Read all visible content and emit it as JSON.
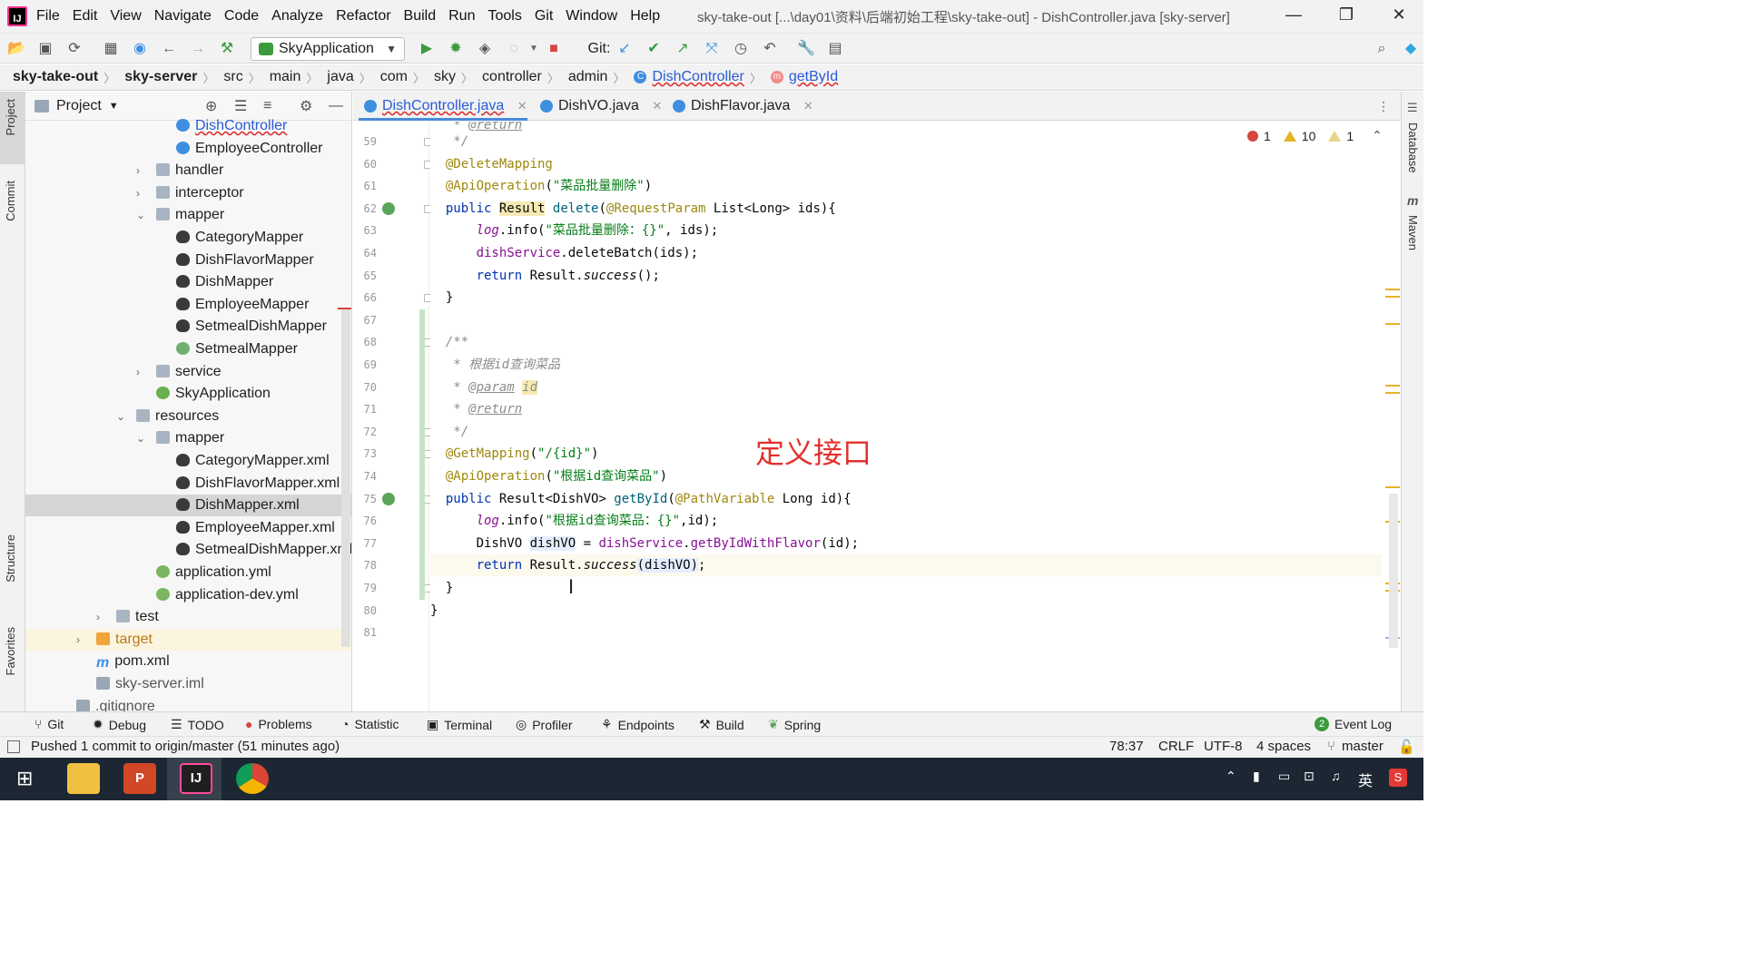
{
  "window": {
    "title": "sky-take-out [...\\day01\\资料\\后端初始工程\\sky-take-out] - DishController.java [sky-server]",
    "menu": [
      "File",
      "Edit",
      "View",
      "Navigate",
      "Code",
      "Analyze",
      "Refactor",
      "Build",
      "Run",
      "Tools",
      "Git",
      "Window",
      "Help"
    ],
    "controls": {
      "minimize": "—",
      "restore": "❐",
      "close": "✕"
    }
  },
  "toolbar": {
    "run_config": "SkyApplication",
    "git_label": "Git:"
  },
  "breadcrumb": [
    "sky-take-out",
    "sky-server",
    "src",
    "main",
    "java",
    "com",
    "sky",
    "controller",
    "admin",
    "DishController",
    "getById"
  ],
  "left_strip": {
    "project": "Project",
    "commit": "Commit",
    "structure": "Structure",
    "favorites": "Favorites"
  },
  "right_strip": {
    "database": "Database",
    "maven": "Maven"
  },
  "project_panel": {
    "title": "Project",
    "rows": [
      {
        "label": "DishController",
        "icon": "class",
        "indent": 2
      },
      {
        "label": "EmployeeController",
        "icon": "class",
        "indent": 2
      },
      {
        "label": "handler",
        "icon": "folder",
        "indent": 1,
        "arrow": "›"
      },
      {
        "label": "interceptor",
        "icon": "folder",
        "indent": 1,
        "arrow": "›"
      },
      {
        "label": "mapper",
        "icon": "folder",
        "indent": 1,
        "arrow": "⌄"
      },
      {
        "label": "CategoryMapper",
        "icon": "mapper",
        "indent": 2
      },
      {
        "label": "DishFlavorMapper",
        "icon": "mapper",
        "indent": 2
      },
      {
        "label": "DishMapper",
        "icon": "mapper",
        "indent": 2
      },
      {
        "label": "EmployeeMapper",
        "icon": "mapper",
        "indent": 2
      },
      {
        "label": "SetmealDishMapper",
        "icon": "mapper",
        "indent": 2
      },
      {
        "label": "SetmealMapper",
        "icon": "iface",
        "indent": 2
      },
      {
        "label": "service",
        "icon": "folder",
        "indent": 1,
        "arrow": "›"
      },
      {
        "label": "SkyApplication",
        "icon": "spring",
        "indent": 1
      },
      {
        "label": "resources",
        "icon": "folder",
        "indent": 0,
        "arrow": "⌄"
      },
      {
        "label": "mapper",
        "icon": "folder",
        "indent": 1,
        "arrow": "⌄"
      },
      {
        "label": "CategoryMapper.xml",
        "icon": "mapper",
        "indent": 2
      },
      {
        "label": "DishFlavorMapper.xml",
        "icon": "mapper",
        "indent": 2
      },
      {
        "label": "DishMapper.xml",
        "icon": "mapper",
        "indent": 2,
        "selected": true
      },
      {
        "label": "EmployeeMapper.xml",
        "icon": "mapper",
        "indent": 2
      },
      {
        "label": "SetmealDishMapper.xml",
        "icon": "mapper",
        "indent": 2
      },
      {
        "label": "application.yml",
        "icon": "yml",
        "indent": 1
      },
      {
        "label": "application-dev.yml",
        "icon": "yml",
        "indent": 1
      },
      {
        "label": "test",
        "icon": "folder",
        "indent": -1,
        "arrow": "›"
      },
      {
        "label": "target",
        "icon": "folder-o",
        "indent": -2,
        "arrow": "›"
      },
      {
        "label": "pom.xml",
        "icon": "m",
        "indent": -2
      },
      {
        "label": "sky-server.iml",
        "icon": "file",
        "indent": -2
      },
      {
        "label": ".gitignore",
        "icon": "file",
        "indent": -3
      }
    ]
  },
  "editor": {
    "tabs": [
      {
        "label": "DishController.java",
        "active": true
      },
      {
        "label": "DishVO.java",
        "active": false
      },
      {
        "label": "DishFlavor.java",
        "active": false
      }
    ],
    "inspections": {
      "errors": "1",
      "warnings": "10",
      "weak_warnings": "1"
    },
    "lines": [
      {
        "n": "59",
        "html": "   <span class=\"cm\">*/</span>"
      },
      {
        "n": "60",
        "html": "  <span class=\"ann\">@DeleteMapping</span>"
      },
      {
        "n": "61",
        "html": "  <span class=\"ann\">@ApiOperation</span>(<span class=\"str\">\"菜品批量删除\"</span>)"
      },
      {
        "n": "62",
        "html": "  <span class=\"kw\">public</span> <span class=\"bgy\">Result</span> <span class=\"mth\">delete</span>(<span class=\"ann\">@RequestParam</span> List&lt;Long&gt; ids){"
      },
      {
        "n": "63",
        "html": "      <span class=\"fld it\">log</span>.info(<span class=\"str\">\"菜品批量删除：{}\"</span>, ids);"
      },
      {
        "n": "64",
        "html": "      <span class=\"fld\">dishService</span>.deleteBatch(ids);"
      },
      {
        "n": "65",
        "html": "      <span class=\"kw\">return</span> Result.<span class=\"it\">success</span>();"
      },
      {
        "n": "66",
        "html": "  }"
      },
      {
        "n": "67",
        "html": ""
      },
      {
        "n": "68",
        "html": "  <span class=\"cm\">/**</span>"
      },
      {
        "n": "69",
        "html": "   <span class=\"cm\">* 根据id查询菜品</span>"
      },
      {
        "n": "70",
        "html": "   <span class=\"cm\">* </span><span class=\"tag\">@param</span> <span class=\"cm bgy\">id</span>"
      },
      {
        "n": "71",
        "html": "   <span class=\"cm\">* </span><span class=\"tag\">@return</span>"
      },
      {
        "n": "72",
        "html": "   <span class=\"cm\">*/</span>"
      },
      {
        "n": "73",
        "html": "  <span class=\"ann\">@GetMapping</span>(<span class=\"str\">\"/{id}\"</span>)"
      },
      {
        "n": "74",
        "html": "  <span class=\"ann\">@ApiOperation</span>(<span class=\"str\">\"根据id查询菜品\"</span>)"
      },
      {
        "n": "75",
        "html": "  <span class=\"kw\">public</span> Result&lt;DishVO&gt; <span class=\"mth\">getById</span>(<span class=\"ann\">@PathVariable</span> Long id){"
      },
      {
        "n": "76",
        "html": "      <span class=\"fld it\">log</span>.info(<span class=\"str\">\"根据id查询菜品：{}\"</span>,id);"
      },
      {
        "n": "77",
        "html": "      DishVO <span class=\"bgb\">dishVO</span> = <span class=\"fld\">dishService</span>.<span class=\"fld\">getByIdWithFlavor</span>(id);"
      },
      {
        "n": "78",
        "html": "      <span class=\"kw\">return</span> Result.<span class=\"it\">success</span><span class=\"bgb\">(dishVO)</span>;"
      },
      {
        "n": "79",
        "html": "  }"
      },
      {
        "n": "80",
        "html": "}"
      },
      {
        "n": "81",
        "html": ""
      }
    ],
    "callout": "定义接口"
  },
  "tool_windows": [
    "Git",
    "Debug",
    "TODO",
    "Problems",
    "Statistic",
    "Terminal",
    "Profiler",
    "Endpoints",
    "Build",
    "Spring"
  ],
  "event_log": "Event Log",
  "status": {
    "message": "Pushed 1 commit to origin/master (51 minutes ago)",
    "position": "78:37",
    "line_sep": "CRLF",
    "encoding": "UTF-8",
    "indent": "4 spaces",
    "branch": "master"
  },
  "taskbar": {
    "ime": "英",
    "apps": [
      "Windows",
      "File Explorer",
      "PowerPoint",
      "IntelliJ IDEA",
      "Chrome"
    ]
  }
}
